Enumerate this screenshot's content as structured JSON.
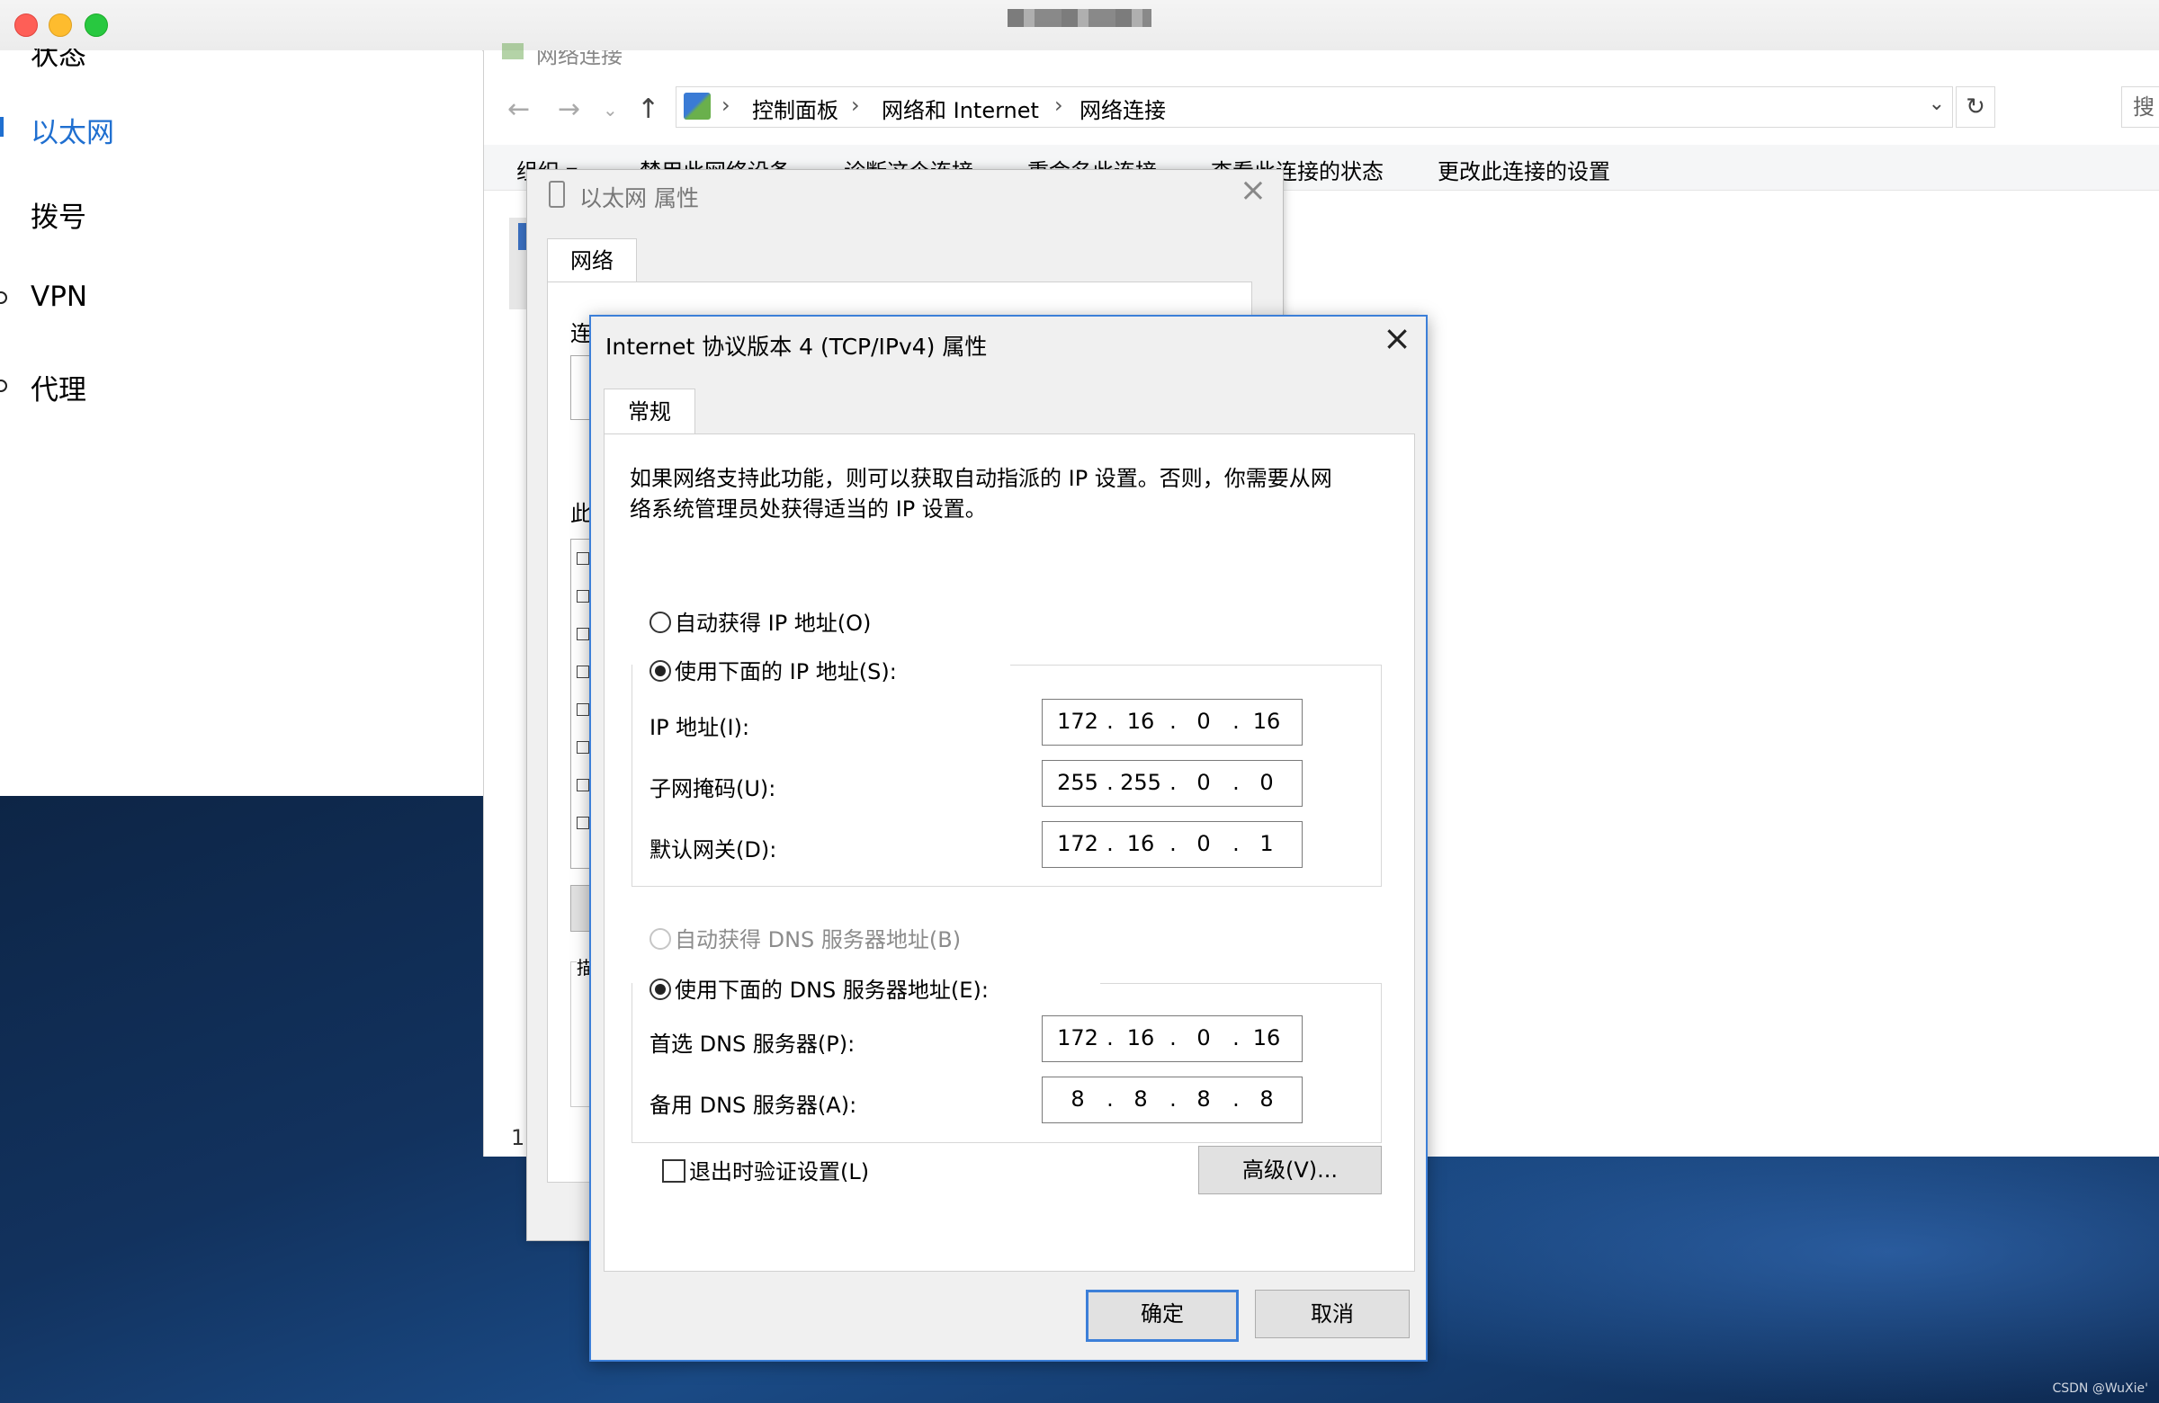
{
  "mac_window": {
    "title_blurred": true
  },
  "settings": {
    "partial_top_label": "状态",
    "items": [
      {
        "label": "以太网",
        "active": true
      },
      {
        "label": "拨号",
        "active": false
      },
      {
        "label": "VPN",
        "active": false
      },
      {
        "label": "代理",
        "active": false
      }
    ]
  },
  "explorer": {
    "window_title": "网络连接",
    "breadcrumbs": [
      "控制面板",
      "网络和 Internet",
      "网络连接"
    ],
    "search_placeholder": "搜",
    "commands": [
      "组织 ▾",
      "禁用此网络设备",
      "诊断这个连接",
      "重命名此连接",
      "查看此连接的状态",
      "更改此连接的设置"
    ],
    "status_count": "1"
  },
  "ethernet_dialog": {
    "title": "以太网 属性",
    "tab": "网络",
    "frag_connect": "连",
    "frag_this": "此",
    "frag_desc": "描"
  },
  "ipv4_dialog": {
    "title": "Internet 协议版本 4 (TCP/IPv4) 属性",
    "tab": "常规",
    "intro": "如果网络支持此功能，则可以获取自动指派的 IP 设置。否则，你需要从网络系统管理员处获得适当的 IP 设置。",
    "ip_auto_label": "自动获得 IP 地址(O)",
    "ip_manual_label": "使用下面的 IP 地址(S):",
    "ip_mode": "manual",
    "fields": {
      "ip": {
        "label": "IP 地址(I):",
        "octets": [
          "172",
          "16",
          "0",
          "16"
        ]
      },
      "mask": {
        "label": "子网掩码(U):",
        "octets": [
          "255",
          "255",
          "0",
          "0"
        ]
      },
      "gateway": {
        "label": "默认网关(D):",
        "octets": [
          "172",
          "16",
          "0",
          "1"
        ]
      },
      "dns_primary": {
        "label": "首选 DNS 服务器(P):",
        "octets": [
          "172",
          "16",
          "0",
          "16"
        ]
      },
      "dns_alternate": {
        "label": "备用 DNS 服务器(A):",
        "octets": [
          "8",
          "8",
          "8",
          "8"
        ]
      }
    },
    "dns_auto_label": "自动获得 DNS 服务器地址(B)",
    "dns_manual_label": "使用下面的 DNS 服务器地址(E):",
    "dns_mode": "manual",
    "validate_label": "退出时验证设置(L)",
    "validate_checked": false,
    "advanced_label": "高级(V)...",
    "ok_label": "确定",
    "cancel_label": "取消"
  },
  "watermark": "CSDN @WuXie'",
  "colors": {
    "accent": "#1f6fd0",
    "dialog_border": "#3c7fd8"
  }
}
